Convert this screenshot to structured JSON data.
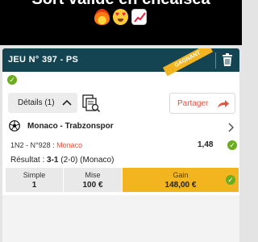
{
  "story": {
    "caption": "Sort validé en chealsea",
    "emojis": [
      "fire-emoji",
      "heart-eyes-emoji",
      "chart-increasing-emoji"
    ]
  },
  "ticket": {
    "title": "JEU N° 397 - PS",
    "badge": "GAGNANT",
    "details_label": "Détails (1)",
    "share_label": "Partager",
    "match": "Monaco - Trabzonspor",
    "market": "1N2 - N°928 :",
    "pick": "Monaco",
    "odds": "1,48",
    "result_label": "Résultat :",
    "result_score": "3-1",
    "result_extra": "(2-0) (Monaco)",
    "summary": {
      "type_label": "Simple",
      "type_value": "1",
      "stake_label": "Mise",
      "stake_value": "100 €",
      "gain_label": "Gain",
      "gain_value": "148,00 €"
    }
  },
  "colors": {
    "header": "#144452",
    "accent": "#e8533f",
    "winning": "#f2b51f",
    "success": "#6cad1d"
  }
}
